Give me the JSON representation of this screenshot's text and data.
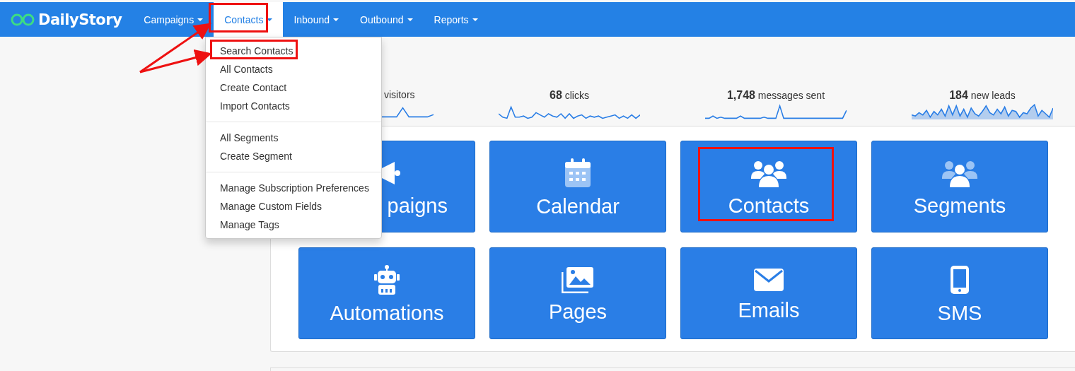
{
  "brand": "DailyStory",
  "nav": [
    {
      "label": "Campaigns",
      "selected": false
    },
    {
      "label": "Contacts",
      "selected": true
    },
    {
      "label": "Inbound",
      "selected": false
    },
    {
      "label": "Outbound",
      "selected": false
    },
    {
      "label": "Reports",
      "selected": false
    }
  ],
  "dropdown": {
    "groups": [
      [
        "Search Contacts",
        "All Contacts",
        "Create Contact",
        "Import Contacts"
      ],
      [
        "All Segments",
        "Create Segment"
      ],
      [
        "Manage Subscription Preferences",
        "Manage Custom Fields",
        "Manage Tags"
      ]
    ]
  },
  "stats": [
    {
      "label": "visitors",
      "kind": "line"
    },
    {
      "value": "68",
      "label": "clicks",
      "kind": "line"
    },
    {
      "value": "1,748",
      "label": "messages sent",
      "kind": "line"
    },
    {
      "value": "184",
      "label": "new leads",
      "kind": "area"
    }
  ],
  "tiles": [
    {
      "label": "paigns",
      "kind": "megaphone",
      "partial": true
    },
    {
      "label": "Calendar",
      "kind": "calendar",
      "partial": false
    },
    {
      "label": "Contacts",
      "kind": "users",
      "partial": false
    },
    {
      "label": "Segments",
      "kind": "group",
      "partial": false
    },
    {
      "label": "Automations",
      "kind": "robot",
      "partial": false
    },
    {
      "label": "Pages",
      "kind": "images",
      "partial": false
    },
    {
      "label": "Emails",
      "kind": "envelope",
      "partial": false
    },
    {
      "label": "SMS",
      "kind": "phone",
      "partial": false
    }
  ]
}
